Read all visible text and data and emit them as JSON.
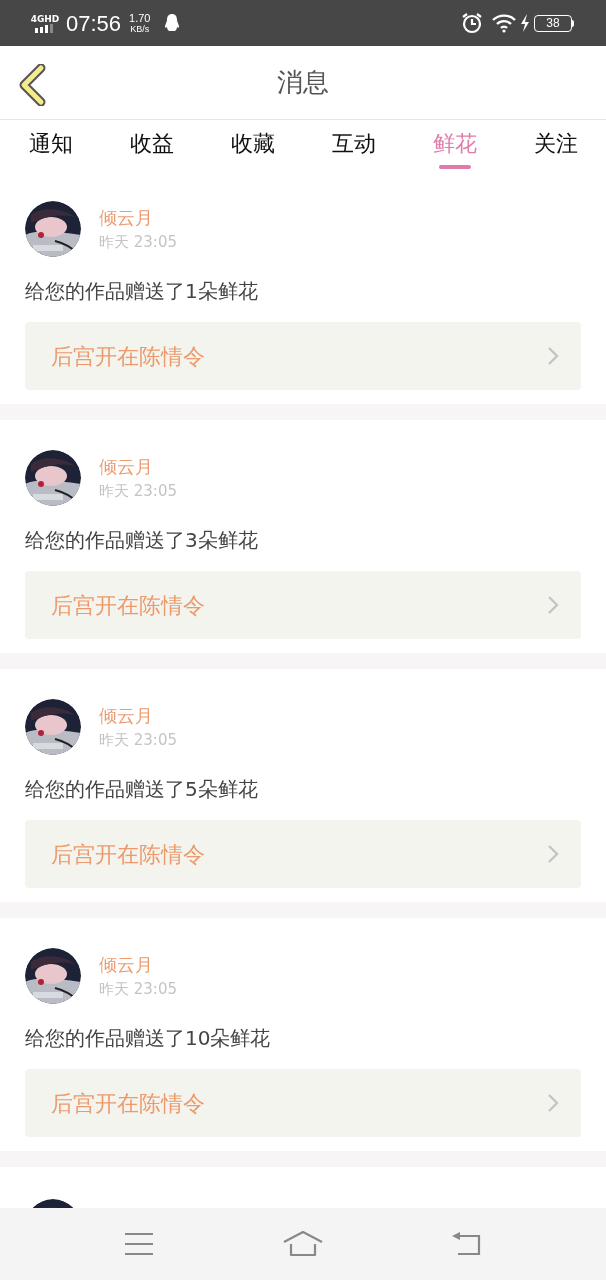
{
  "status_bar": {
    "network": "4GHD",
    "time": "07:56",
    "speed": "1.70",
    "speed_unit": "KB/s",
    "battery": "38"
  },
  "header": {
    "title": "消息"
  },
  "tabs": [
    {
      "label": "通知",
      "selected": false
    },
    {
      "label": "收益",
      "selected": false
    },
    {
      "label": "收藏",
      "selected": false
    },
    {
      "label": "互动",
      "selected": false
    },
    {
      "label": "鲜花",
      "selected": true
    },
    {
      "label": "关注",
      "selected": false
    }
  ],
  "messages": [
    {
      "kind": "message",
      "name": "倾云月",
      "time": "昨天 23:05",
      "text": "给您的作品赠送了1朵鲜花",
      "work": "后宫开在陈情令"
    },
    {
      "kind": "message",
      "name": "倾云月",
      "time": "昨天 23:05",
      "text": "给您的作品赠送了3朵鲜花",
      "work": "后宫开在陈情令"
    },
    {
      "kind": "message",
      "name": "倾云月",
      "time": "昨天 23:05",
      "text": "给您的作品赠送了5朵鲜花",
      "work": "后宫开在陈情令"
    },
    {
      "kind": "message",
      "name": "倾云月",
      "time": "昨天 23:05",
      "text": "给您的作品赠送了10朵鲜花",
      "work": "后宫开在陈情令"
    },
    {
      "kind": "partial"
    }
  ]
}
